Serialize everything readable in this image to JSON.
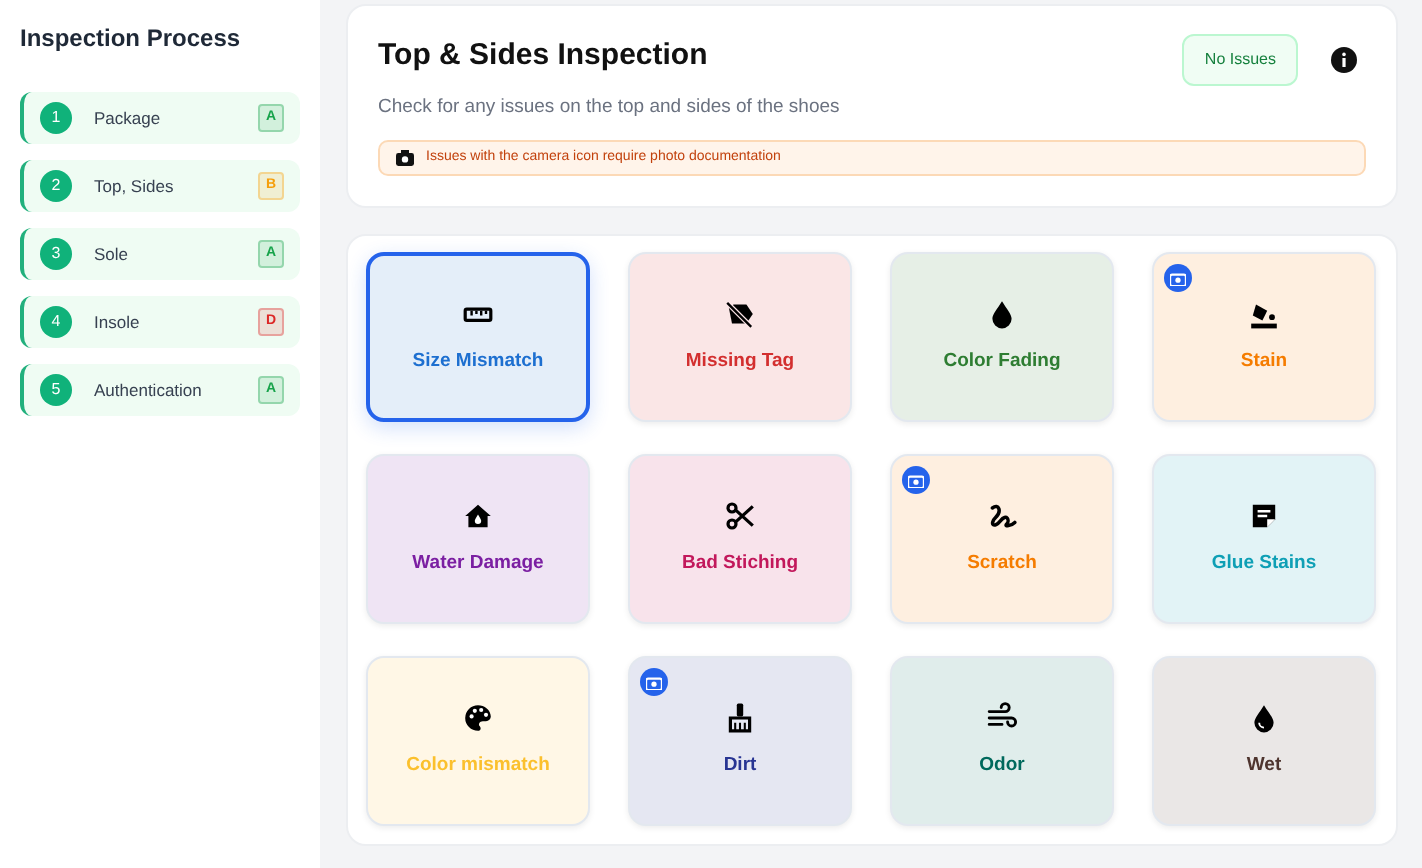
{
  "sidebar": {
    "title": "Inspection Process",
    "steps": [
      {
        "number": "1",
        "label": "Package",
        "grade": "A",
        "color": "#16a34a"
      },
      {
        "number": "2",
        "label": "Top, Sides",
        "grade": "B",
        "color": "#f59e0b"
      },
      {
        "number": "3",
        "label": "Sole",
        "grade": "A",
        "color": "#16a34a"
      },
      {
        "number": "4",
        "label": "Insole",
        "grade": "D",
        "color": "#dc2626"
      },
      {
        "number": "5",
        "label": "Authentication",
        "grade": "A",
        "color": "#16a34a"
      }
    ]
  },
  "header": {
    "title": "Top & Sides Inspection",
    "subtitle": "Check for any issues on the top and sides of the shoes",
    "status": "No Issues",
    "notice": "Issues with the camera icon require photo documentation"
  },
  "issues": [
    {
      "label": "Size Mismatch",
      "color": "#1d6fd0",
      "camera": false,
      "selected": true
    },
    {
      "label": "Missing Tag",
      "color": "#d32f2f",
      "camera": false,
      "selected": false
    },
    {
      "label": "Color Fading",
      "color": "#2e7d32",
      "camera": false,
      "selected": false
    },
    {
      "label": "Stain",
      "color": "#f57c00",
      "camera": true,
      "selected": false
    },
    {
      "label": "Water Damage",
      "color": "#7b1fa2",
      "camera": false,
      "selected": false
    },
    {
      "label": "Bad Stiching",
      "color": "#c2185b",
      "camera": false,
      "selected": false
    },
    {
      "label": "Scratch",
      "color": "#f57c00",
      "camera": true,
      "selected": false
    },
    {
      "label": "Glue Stains",
      "color": "#0e9fb5",
      "camera": false,
      "selected": false
    },
    {
      "label": "Color mismatch",
      "color": "#fbc02d",
      "camera": false,
      "selected": false
    },
    {
      "label": "Dirt",
      "color": "#283593",
      "camera": true,
      "selected": false
    },
    {
      "label": "Odor",
      "color": "#00695c",
      "camera": false,
      "selected": false
    },
    {
      "label": "Wet",
      "color": "#4e342e",
      "camera": false,
      "selected": false
    }
  ]
}
